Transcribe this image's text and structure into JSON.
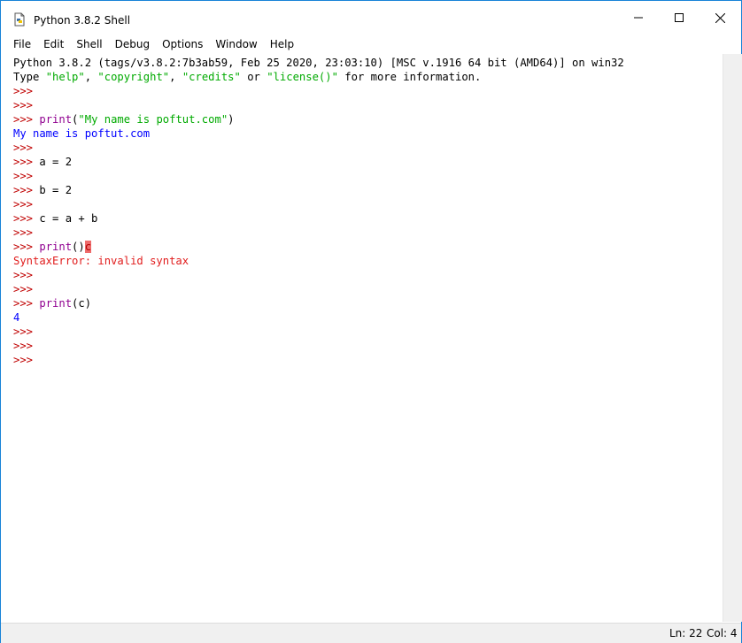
{
  "window": {
    "title": "Python 3.8.2 Shell",
    "accent_color": "#1883d7"
  },
  "menu": [
    "File",
    "Edit",
    "Shell",
    "Debug",
    "Options",
    "Window",
    "Help"
  ],
  "shell": {
    "prompt": ">>>",
    "banner_1": "Python 3.8.2 (tags/v3.8.2:7b3ab59, Feb 25 2020, 23:03:10) [MSC v.1916 64 bit (AMD64)] on win32",
    "banner_2a": "Type ",
    "banner_2b": "\"help\"",
    "banner_2c": ", ",
    "banner_2d": "\"copyright\"",
    "banner_2e": ", ",
    "banner_2f": "\"credits\"",
    "banner_2g": " or ",
    "banner_2h": "\"license()\"",
    "banner_2i": " for more information.",
    "cmd1_func": "print",
    "cmd1_open": "(",
    "cmd1_str": "\"My name is poftut.com\"",
    "cmd1_close": ")",
    "out1": "My name is poftut.com",
    "cmd2": "a = 2",
    "cmd3": "b = 2",
    "cmd4": "c = a + b",
    "cmd5_func": "print",
    "cmd5_rest": "()",
    "cmd5_err_char": "c",
    "error": "SyntaxError: invalid syntax",
    "cmd6_func": "print",
    "cmd6_rest": "(c)",
    "out2": "4"
  },
  "status": {
    "line": "Ln: 22",
    "col": "Col: 4"
  },
  "colors": {
    "prompt": "#c00000",
    "output": "#0000ff",
    "error": "#e11d1d",
    "string": "#00aa00",
    "builtin": "#900090"
  }
}
